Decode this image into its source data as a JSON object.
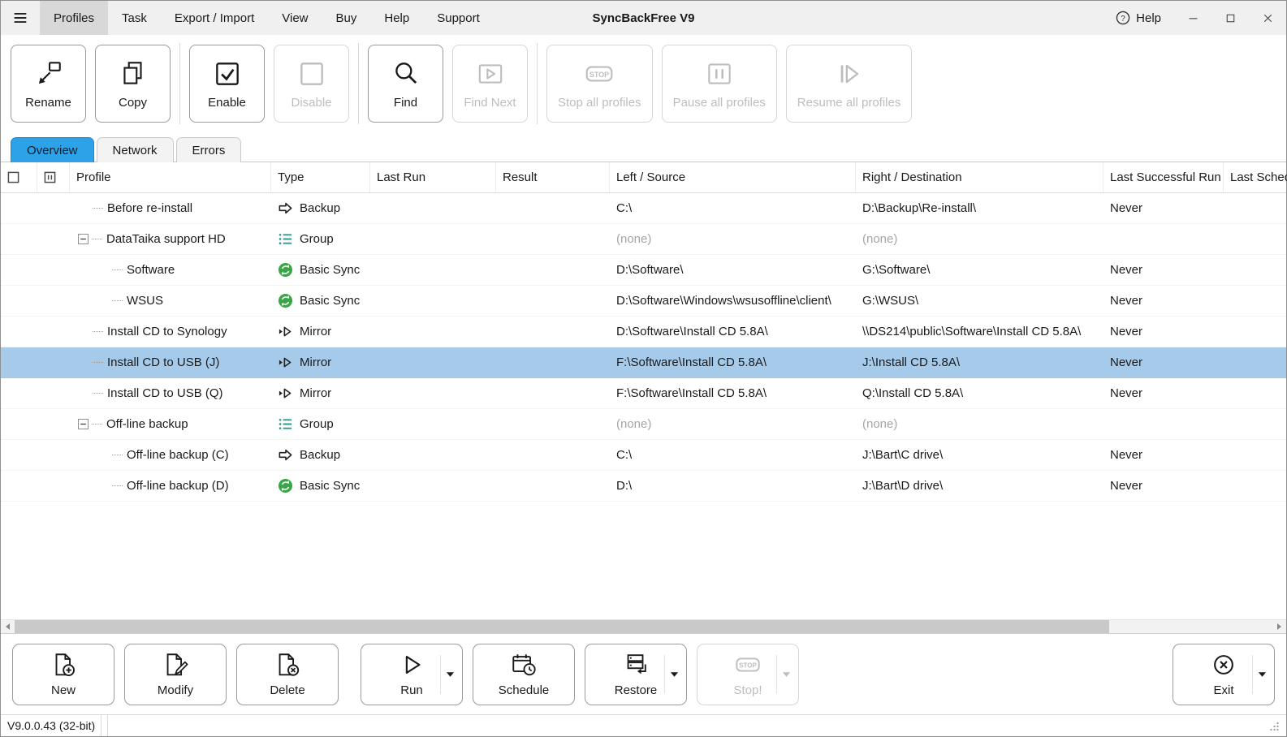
{
  "window": {
    "title": "SyncBackFree V9",
    "help_label": "Help",
    "controls": [
      "minimize",
      "maximize",
      "close"
    ]
  },
  "menu": {
    "items": [
      {
        "label": "Profiles",
        "active": true
      },
      {
        "label": "Task",
        "active": false
      },
      {
        "label": "Export / Import",
        "active": false
      },
      {
        "label": "View",
        "active": false
      },
      {
        "label": "Buy",
        "active": false
      },
      {
        "label": "Help",
        "active": false
      },
      {
        "label": "Support",
        "active": false
      }
    ]
  },
  "toolbar": {
    "groups": [
      [
        {
          "label": "Rename",
          "icon": "rename",
          "enabled": true
        },
        {
          "label": "Copy",
          "icon": "copy",
          "enabled": true
        }
      ],
      [
        {
          "label": "Enable",
          "icon": "check",
          "enabled": true
        },
        {
          "label": "Disable",
          "icon": "uncheck",
          "enabled": false
        }
      ],
      [
        {
          "label": "Find",
          "icon": "find",
          "enabled": true
        },
        {
          "label": "Find Next",
          "icon": "findnext",
          "enabled": false
        }
      ],
      [
        {
          "label": "Stop all profiles",
          "icon": "stopsign",
          "enabled": false
        },
        {
          "label": "Pause all profiles",
          "icon": "pauseall",
          "enabled": false
        },
        {
          "label": "Resume all profiles",
          "icon": "resumeall",
          "enabled": false
        }
      ]
    ]
  },
  "tabs": [
    {
      "label": "Overview",
      "active": true
    },
    {
      "label": "Network",
      "active": false
    },
    {
      "label": "Errors",
      "active": false
    }
  ],
  "table": {
    "columns": [
      "Profile",
      "Type",
      "Last Run",
      "Result",
      "Left / Source",
      "Right / Destination",
      "Last Successful Run",
      "Last Sched"
    ],
    "rows": [
      {
        "profile": "Before re-install",
        "level": 0,
        "group": false,
        "selected": false,
        "type": "Backup",
        "type_icon": "backup",
        "last_run": "",
        "result": "",
        "source": "C:\\",
        "destination": "D:\\Backup\\Re-install\\",
        "last_successful_run": "Never"
      },
      {
        "profile": "DataTaika support HD",
        "level": 0,
        "group": true,
        "selected": false,
        "type": "Group",
        "type_icon": "group",
        "last_run": "",
        "result": "",
        "source": "(none)",
        "destination": "(none)",
        "last_successful_run": ""
      },
      {
        "profile": "Software",
        "level": 1,
        "group": false,
        "selected": false,
        "type": "Basic Sync",
        "type_icon": "sync",
        "last_run": "",
        "result": "",
        "source": "D:\\Software\\",
        "destination": "G:\\Software\\",
        "last_successful_run": "Never"
      },
      {
        "profile": "WSUS",
        "level": 1,
        "group": false,
        "selected": false,
        "type": "Basic Sync",
        "type_icon": "sync",
        "last_run": "",
        "result": "",
        "source": "D:\\Software\\Windows\\wsusoffline\\client\\",
        "destination": "G:\\WSUS\\",
        "last_successful_run": "Never"
      },
      {
        "profile": "Install CD to Synology",
        "level": 0,
        "group": false,
        "selected": false,
        "type": "Mirror",
        "type_icon": "mirror",
        "last_run": "",
        "result": "",
        "source": "D:\\Software\\Install CD 5.8A\\",
        "destination": "\\\\DS214\\public\\Software\\Install CD 5.8A\\",
        "last_successful_run": "Never"
      },
      {
        "profile": "Install CD to USB (J)",
        "level": 0,
        "group": false,
        "selected": true,
        "type": "Mirror",
        "type_icon": "mirror",
        "last_run": "",
        "result": "",
        "source": "F:\\Software\\Install CD 5.8A\\",
        "destination": "J:\\Install CD 5.8A\\",
        "last_successful_run": "Never"
      },
      {
        "profile": "Install CD to USB (Q)",
        "level": 0,
        "group": false,
        "selected": false,
        "type": "Mirror",
        "type_icon": "mirror",
        "last_run": "",
        "result": "",
        "source": "F:\\Software\\Install CD 5.8A\\",
        "destination": "Q:\\Install CD 5.8A\\",
        "last_successful_run": "Never"
      },
      {
        "profile": "Off-line backup",
        "level": 0,
        "group": true,
        "selected": false,
        "type": "Group",
        "type_icon": "group",
        "last_run": "",
        "result": "",
        "source": "(none)",
        "destination": "(none)",
        "last_successful_run": ""
      },
      {
        "profile": "Off-line backup (C)",
        "level": 1,
        "group": false,
        "selected": false,
        "type": "Backup",
        "type_icon": "backup",
        "last_run": "",
        "result": "",
        "source": "C:\\",
        "destination": "J:\\Bart\\C drive\\",
        "last_successful_run": "Never"
      },
      {
        "profile": "Off-line backup (D)",
        "level": 1,
        "group": false,
        "selected": false,
        "type": "Basic Sync",
        "type_icon": "sync",
        "last_run": "",
        "result": "",
        "source": "D:\\",
        "destination": "J:\\Bart\\D drive\\",
        "last_successful_run": "Never"
      }
    ]
  },
  "bottom_toolbar": {
    "groups": [
      {
        "align": "left",
        "buttons": [
          {
            "label": "New",
            "icon": "new",
            "enabled": true,
            "dropdown": false
          },
          {
            "label": "Modify",
            "icon": "modify",
            "enabled": true,
            "dropdown": false
          },
          {
            "label": "Delete",
            "icon": "delete",
            "enabled": true,
            "dropdown": false
          }
        ]
      },
      {
        "align": "left",
        "buttons": [
          {
            "label": "Run",
            "icon": "run",
            "enabled": true,
            "dropdown": true
          },
          {
            "label": "Schedule",
            "icon": "schedule",
            "enabled": true,
            "dropdown": false
          },
          {
            "label": "Restore",
            "icon": "restore",
            "enabled": true,
            "dropdown": true
          },
          {
            "label": "Stop!",
            "icon": "stopsign",
            "enabled": false,
            "dropdown": true
          }
        ]
      },
      {
        "align": "right",
        "buttons": [
          {
            "label": "Exit",
            "icon": "exit",
            "enabled": true,
            "dropdown": true
          }
        ]
      }
    ]
  },
  "status_bar": {
    "version": "V9.0.0.43 (32-bit)"
  },
  "colors": {
    "active_tab": "#2da2e8",
    "selected_row": "#a6cbea",
    "sync_icon_green": "#3ba648",
    "group_icon_teal": "#2a9b90"
  }
}
